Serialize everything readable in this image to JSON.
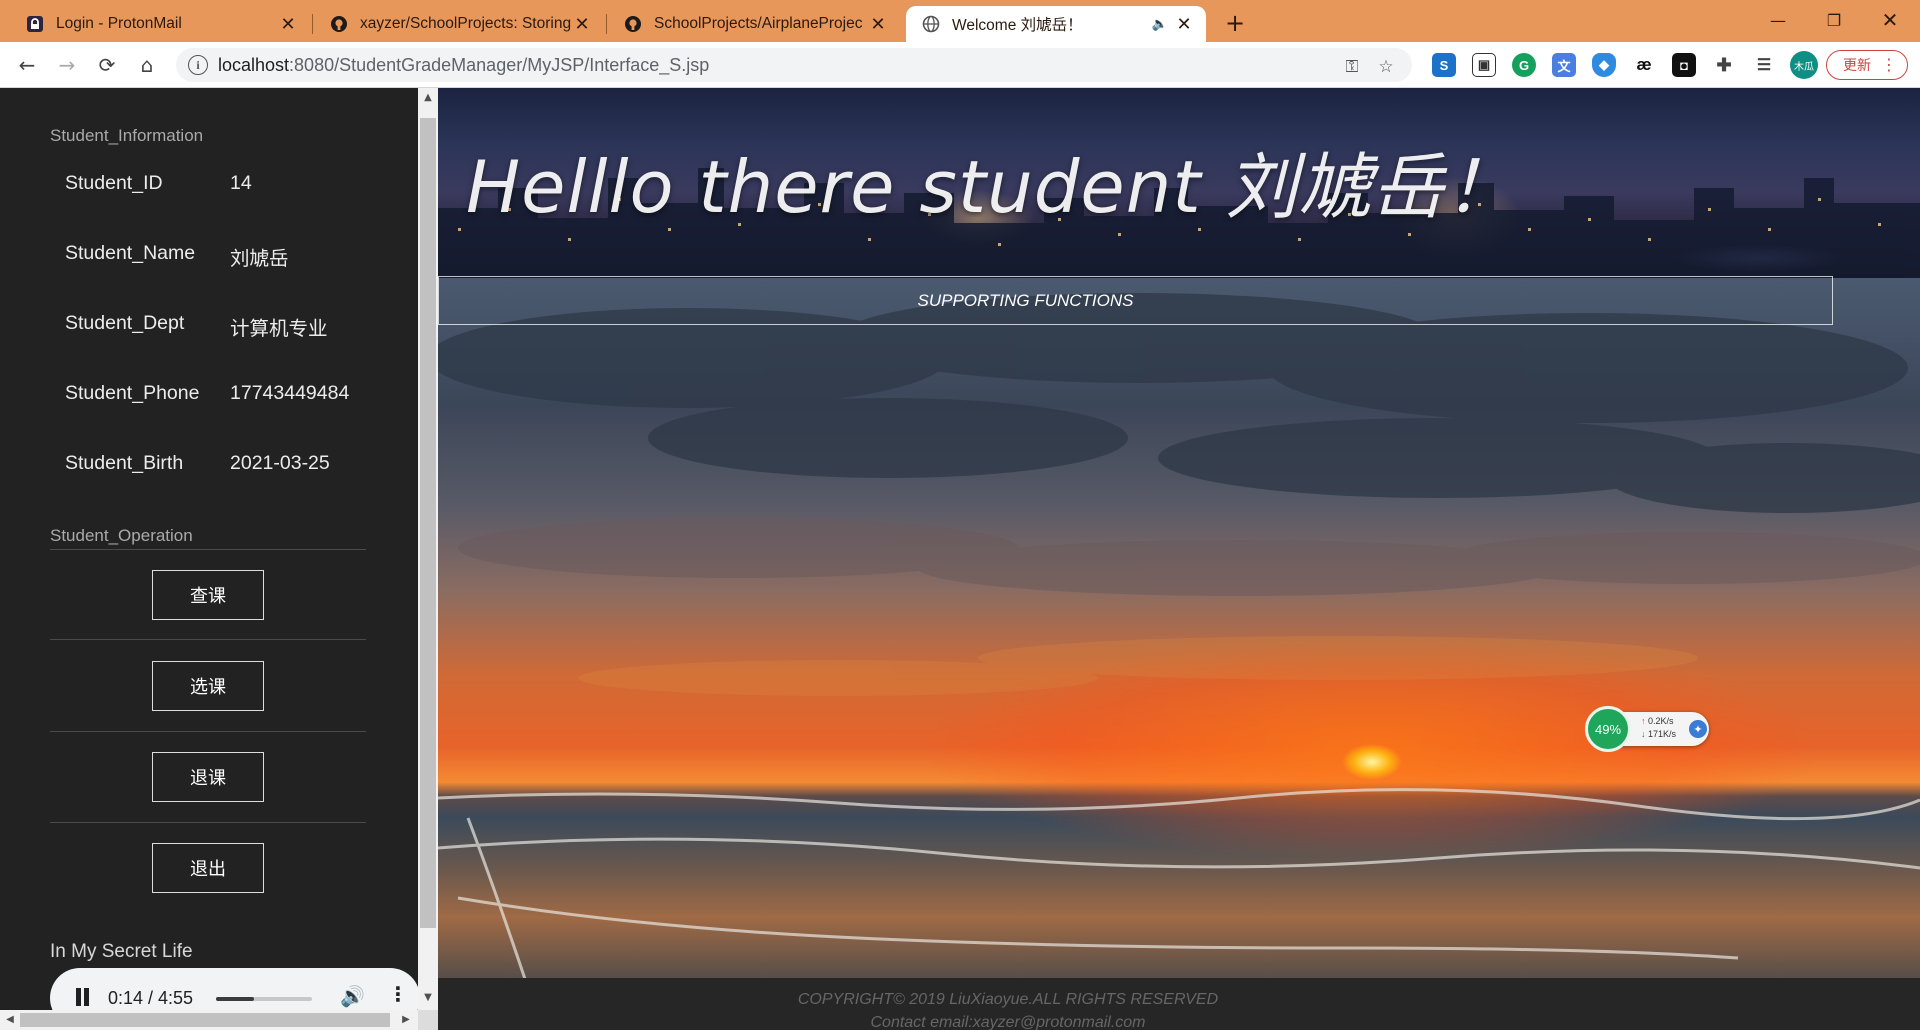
{
  "browser": {
    "tabs": [
      {
        "title": "Login - ProtonMail",
        "icon": "protonmail-icon",
        "active": false
      },
      {
        "title": "xayzer/SchoolProjects: Storing",
        "icon": "github-icon",
        "active": false
      },
      {
        "title": "SchoolProjects/AirplaneProjec",
        "icon": "github-icon",
        "active": false
      },
      {
        "title": "Welcome 刘虓岳！",
        "icon": "globe-icon",
        "active": true
      }
    ],
    "url_host": "localhost",
    "url_path": ":8080/StudentGradeManager/MyJSP/Interface_S.jsp",
    "update_label": "更新",
    "avatar_label": "木瓜",
    "accent_color": "#e8975b"
  },
  "sidebar": {
    "info_title": "Student_Information",
    "info_rows": [
      {
        "label": "Student_ID",
        "value": "14"
      },
      {
        "label": "Student_Name",
        "value": "刘虓岳"
      },
      {
        "label": "Student_Dept",
        "value": "计算机专业"
      },
      {
        "label": "Student_Phone",
        "value": "17743449484"
      },
      {
        "label": "Student_Birth",
        "value": "2021-03-25"
      }
    ],
    "op_title": "Student_Operation",
    "operations": [
      "查课",
      "选课",
      "退课",
      "退出"
    ],
    "song_title": "In My Secret Life",
    "audio": {
      "time": "0:14 / 4:55",
      "progress": 0.05
    }
  },
  "main": {
    "greeting": "Helllo there student 刘虓岳！",
    "support_label": "SUPPORTING FUNCTIONS",
    "net_widget": {
      "percent": "49%",
      "up": "0.2K/s",
      "down": "171K/s"
    },
    "footer_line1": "COPYRIGHT© 2019 LiuXiaoyue.ALL RIGHTS RESERVED",
    "footer_line2": "Contact email:xayzer@protonmail.com"
  }
}
